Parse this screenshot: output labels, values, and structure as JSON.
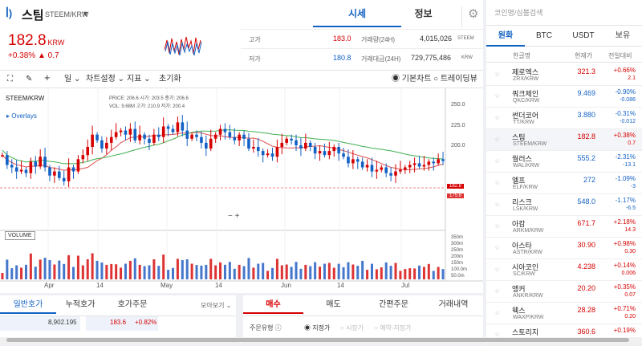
{
  "coin": {
    "name": "스팀",
    "pair": "STEEM/KRW",
    "price": "182.8",
    "unit": "KRW",
    "change_pct": "+0.38%",
    "change_amt": "▲ 0.7"
  },
  "tabs": {
    "quote": "시세",
    "info": "정보"
  },
  "stats": {
    "high_label": "고가",
    "high": "183.0",
    "low_label": "저가",
    "low": "180.8",
    "vol_label": "거래량(24H)",
    "vol": "4,015,026",
    "vol_unit": "STEEM",
    "amt_label": "거래대금(24H)",
    "amt": "729,775,486",
    "amt_unit": "KRW"
  },
  "toolbar": {
    "period": "일",
    "chart_settings": "차트설정",
    "indicator": "지표",
    "reset": "초기화",
    "basic": "기본차트",
    "tradingview": "트레이딩뷰"
  },
  "chart": {
    "symbol": "STEEM/KRW",
    "overlays": "Overlays",
    "ohlc": "PRICE: 206.6  시가: 203.5  종가: 206.6",
    "vol_info": "VOL: 9.68M  고가: 210.9  저가: 200.4",
    "volume_label": "VOLUME",
    "price_ticks": [
      "250.0",
      "225.0",
      "200.0",
      "150.0"
    ],
    "vol_ticks": [
      "350m",
      "300m",
      "250m",
      "200m",
      "150m",
      "100.0m",
      "50.0m"
    ],
    "dates": [
      "Apr",
      "14",
      "May",
      "14",
      "Jun",
      "14",
      "Jul",
      "14"
    ],
    "last_price": "182.8",
    "ma_price": "175.6"
  },
  "chart_data": {
    "type": "candlestick",
    "closes": [
      190,
      178,
      175,
      170,
      172,
      168,
      182,
      176,
      188,
      175,
      165,
      170,
      162,
      158,
      175,
      170,
      185,
      190,
      200,
      215,
      208,
      198,
      205,
      212,
      218,
      220,
      215,
      222,
      208,
      215,
      210,
      205,
      215,
      212,
      225,
      222,
      218,
      230,
      220,
      210,
      215,
      212,
      205,
      198,
      210,
      215,
      222,
      218,
      212,
      208,
      215,
      210,
      198,
      200,
      195,
      190,
      192,
      188,
      200,
      205,
      210,
      208,
      202,
      198,
      205,
      200,
      192,
      195,
      190,
      195,
      200,
      192,
      188,
      180,
      185,
      182,
      175,
      178,
      170,
      172,
      175,
      168,
      165,
      170,
      172,
      175,
      178,
      180,
      176,
      178,
      182,
      180,
      185,
      182.8
    ]
  },
  "orderbook": {
    "tab1": "일반호가",
    "tab2": "누적호가",
    "tab3": "호가주문",
    "more": "모아보기",
    "qty": "8,902.195",
    "price": "183.6",
    "pct": "+0.82%"
  },
  "trade": {
    "buy": "매수",
    "sell": "매도",
    "simple": "간편주문",
    "history": "거래내역",
    "type_label": "주문유형",
    "limit": "지정가",
    "market": "시장가",
    "reserve": "예약-지정가"
  },
  "side": {
    "search": "코인명/심볼검색",
    "tabs": [
      "원화",
      "BTC",
      "USDT",
      "보유"
    ],
    "head": {
      "name": "한글명",
      "price": "현재가",
      "change": "전일대비"
    },
    "rows": [
      {
        "name": "제로엑스",
        "pair": "ZRX/KRW",
        "price": "321.3",
        "pct": "+0.66%",
        "amt": "2.1",
        "up": true
      },
      {
        "name": "쿼크체인",
        "pair": "QKC/KRW",
        "price": "9.469",
        "pct": "-0.90%",
        "amt": "-0.086",
        "up": false
      },
      {
        "name": "썬더코어",
        "pair": "TT/KRW",
        "price": "3.880",
        "pct": "-0.31%",
        "amt": "-0.012",
        "up": false
      },
      {
        "name": "스팀",
        "pair": "STEEM/KRW",
        "price": "182.8",
        "pct": "+0.38%",
        "amt": "0.7",
        "up": true
      },
      {
        "name": "월러스",
        "pair": "WAL/KRW",
        "price": "555.2",
        "pct": "-2.31%",
        "amt": "-13.1",
        "up": false
      },
      {
        "name": "엘프",
        "pair": "ELF/KRW",
        "price": "272",
        "pct": "-1.09%",
        "amt": "-3",
        "up": false
      },
      {
        "name": "리스크",
        "pair": "LSK/KRW",
        "price": "548.0",
        "pct": "-1.17%",
        "amt": "-6.5",
        "up": false
      },
      {
        "name": "아캄",
        "pair": "ARKM/KRW",
        "price": "671.7",
        "pct": "+2.18%",
        "amt": "14.3",
        "up": true
      },
      {
        "name": "아스타",
        "pair": "ASTR/KRW",
        "price": "30.90",
        "pct": "+0.98%",
        "amt": "0.30",
        "up": true
      },
      {
        "name": "시아코인",
        "pair": "SC/KRW",
        "price": "4.238",
        "pct": "+0.14%",
        "amt": "0.006",
        "up": true
      },
      {
        "name": "앵커",
        "pair": "ANKR/KRW",
        "price": "20.20",
        "pct": "+0.35%",
        "amt": "0.07",
        "up": true
      },
      {
        "name": "웩스",
        "pair": "WAXP/KRW",
        "price": "28.28",
        "pct": "+0.71%",
        "amt": "0.20",
        "up": true
      },
      {
        "name": "스토리지",
        "pair": "",
        "price": "360.6",
        "pct": "+0.19%",
        "amt": "",
        "up": true
      }
    ]
  }
}
